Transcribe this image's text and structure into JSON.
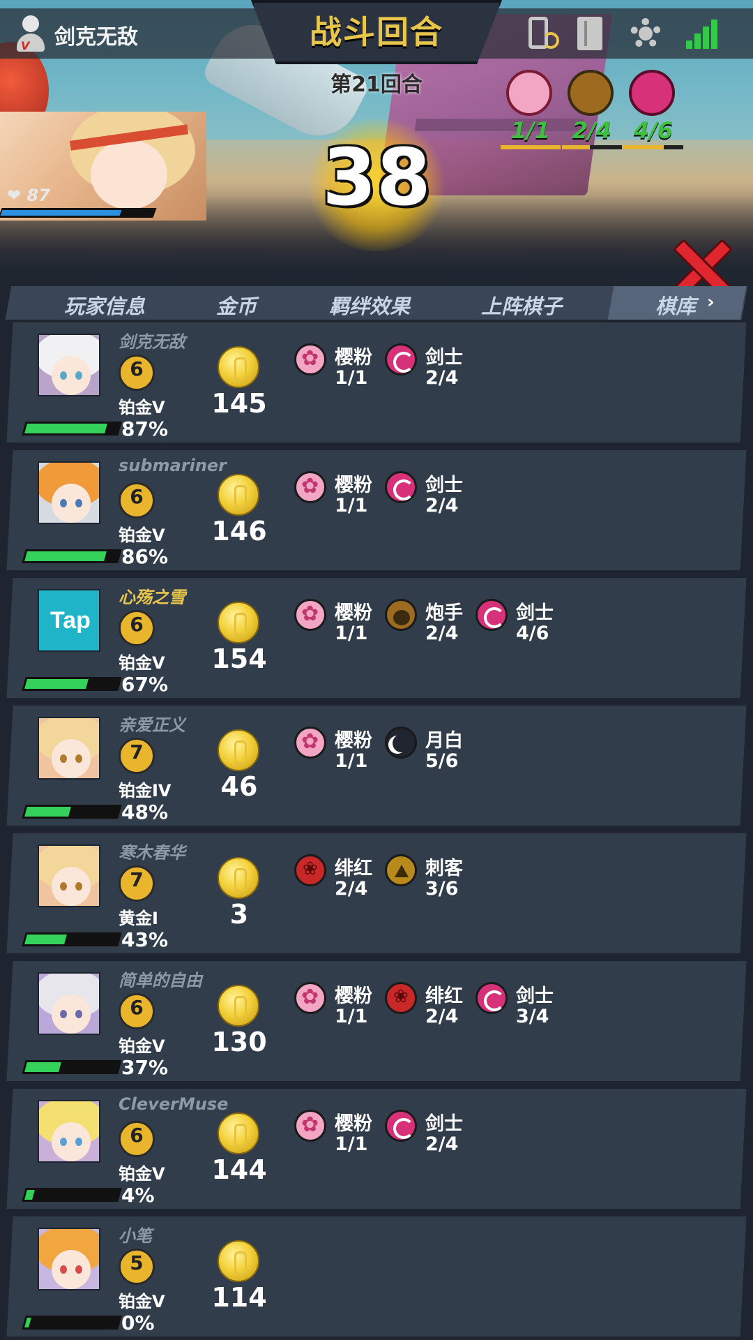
{
  "header": {
    "player_name": "剑克无敌",
    "round_title": "战斗回合",
    "round_sub": "第21回合",
    "hp": "87",
    "hp_fraction": 0.8,
    "countdown": "38",
    "icons": [
      "phone-sync-icon",
      "book-icon",
      "gear-icon",
      "signal-icon"
    ]
  },
  "top_synergies": [
    {
      "icon": "sakura-icon",
      "count": "1/1",
      "color": "#3fbf3f"
    },
    {
      "icon": "cannon-icon",
      "count": "2/4",
      "color": "#3fbf3f"
    },
    {
      "icon": "sword-icon",
      "count": "4/6",
      "color": "#3fbf3f"
    }
  ],
  "tabs": [
    "玩家信息",
    "金币",
    "羁绊效果",
    "上阵棋子",
    "棋库"
  ],
  "players": [
    {
      "name": "剑克无敌",
      "level": "6",
      "rank": "铂金V",
      "xp": "87%",
      "xp_fraction": 0.87,
      "gold": "145",
      "avatar": "white-hair-catgirl",
      "synergies": [
        {
          "icon": "pink",
          "name": "樱粉",
          "count": "1/1"
        },
        {
          "icon": "sword",
          "name": "剑士",
          "count": "2/4"
        }
      ]
    },
    {
      "name": "submariner",
      "level": "6",
      "rank": "铂金V",
      "xp": "86%",
      "xp_fraction": 0.86,
      "gold": "146",
      "avatar": "orange-hair-boy",
      "synergies": [
        {
          "icon": "pink",
          "name": "樱粉",
          "count": "1/1"
        },
        {
          "icon": "sword",
          "name": "剑士",
          "count": "2/4"
        }
      ]
    },
    {
      "name": "心殇之雪",
      "level": "6",
      "rank": "铂金V",
      "xp": "67%",
      "xp_fraction": 0.67,
      "gold": "154",
      "avatar": "tap",
      "avatar_text": "Tap",
      "gold_name": true,
      "synergies": [
        {
          "icon": "pink",
          "name": "樱粉",
          "count": "1/1"
        },
        {
          "icon": "cannon",
          "name": "炮手",
          "count": "2/4"
        },
        {
          "icon": "sword",
          "name": "剑士",
          "count": "4/6"
        }
      ]
    },
    {
      "name": "亲爱正义",
      "level": "7",
      "rank": "铂金IV",
      "xp": "48%",
      "xp_fraction": 0.48,
      "gold": "46",
      "avatar": "blonde-girl",
      "synergies": [
        {
          "icon": "pink",
          "name": "樱粉",
          "count": "1/1"
        },
        {
          "icon": "moon",
          "name": "月白",
          "count": "5/6"
        }
      ]
    },
    {
      "name": "寒木春华",
      "level": "7",
      "rank": "黄金I",
      "xp": "43%",
      "xp_fraction": 0.43,
      "gold": "3",
      "avatar": "blonde-girl",
      "synergies": [
        {
          "icon": "red",
          "name": "绯红",
          "count": "2/4"
        },
        {
          "icon": "assassin",
          "name": "刺客",
          "count": "3/6"
        }
      ]
    },
    {
      "name": "简单的自由",
      "level": "6",
      "rank": "铂金V",
      "xp": "37%",
      "xp_fraction": 0.37,
      "gold": "130",
      "avatar": "silver-hair-boy",
      "synergies": [
        {
          "icon": "pink",
          "name": "樱粉",
          "count": "1/1"
        },
        {
          "icon": "red",
          "name": "绯红",
          "count": "2/4"
        },
        {
          "icon": "sword",
          "name": "剑士",
          "count": "3/4"
        }
      ]
    },
    {
      "name": "CleverMuse",
      "level": "6",
      "rank": "铂金V",
      "xp": "4%",
      "xp_fraction": 0.04,
      "gold": "144",
      "avatar": "headphone-girl",
      "synergies": [
        {
          "icon": "pink",
          "name": "樱粉",
          "count": "1/1"
        },
        {
          "icon": "sword",
          "name": "剑士",
          "count": "2/4"
        }
      ]
    },
    {
      "name": "小笔",
      "level": "5",
      "rank": "铂金V",
      "xp": "0%",
      "xp_fraction": 0.0,
      "gold": "114",
      "avatar": "orange-twintail-girl",
      "synergies": []
    }
  ]
}
